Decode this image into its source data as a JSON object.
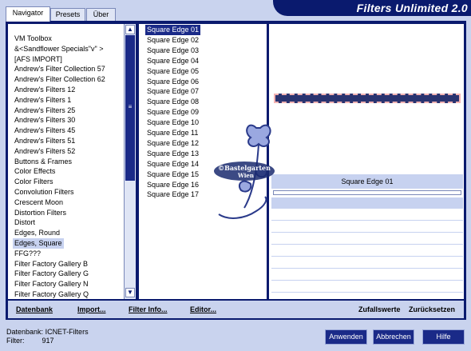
{
  "app": {
    "title": "Filters Unlimited 2.0"
  },
  "tabs": [
    {
      "label": "Navigator",
      "active": true
    },
    {
      "label": "Presets",
      "active": false
    },
    {
      "label": "Über",
      "active": false
    }
  ],
  "categories": [
    "VM Toolbox",
    "&<Sandflower Specials\"v\" >",
    "[AFS IMPORT]",
    "Andrew's Filter Collection 57",
    "Andrew's Filter Collection 62",
    "Andrew's Filters 12",
    "Andrew's Filters 1",
    "Andrew's Filters 25",
    "Andrew's Filters 30",
    "Andrew's Filters 45",
    "Andrew's Filters 51",
    "Andrew's Filters 52",
    "Buttons & Frames",
    "Color Effects",
    "Color Filters",
    "Convolution Filters",
    "Crescent Moon",
    "Distortion Filters",
    "Distort",
    "Edges, Round",
    "Edges, Square",
    "FFG???",
    "Filter Factory Gallery B",
    "Filter Factory Gallery G",
    "Filter Factory Gallery N",
    "Filter Factory Gallery Q"
  ],
  "selected_category": "Edges, Square",
  "filters": [
    "Square Edge 01",
    "Square Edge 02",
    "Square Edge 03",
    "Square Edge 04",
    "Square Edge 05",
    "Square Edge 06",
    "Square Edge 07",
    "Square Edge 08",
    "Square Edge 09",
    "Square Edge 10",
    "Square Edge 11",
    "Square Edge 12",
    "Square Edge 13",
    "Square Edge 14",
    "Square Edge 15",
    "Square Edge 16",
    "Square Edge 17"
  ],
  "selected_filter": "Square Edge 01",
  "control_header": "Square Edge 01",
  "watermark": {
    "line1": "©Bastelgarten",
    "line2": "Wien"
  },
  "toolbar": {
    "datenbank": "Datenbank",
    "import": "Import...",
    "filter_info": "Filter Info...",
    "editor": "Editor...",
    "zufallswerte": "Zufallswerte",
    "zuruecksetzen": "Zurücksetzen"
  },
  "status": {
    "datenbank_label": "Datenbank:",
    "datenbank_value": "ICNET-Filters",
    "filter_label": "Filter:",
    "filter_value": "917"
  },
  "buttons": {
    "apply": "Anwenden",
    "cancel": "Abbrechen",
    "help": "Hilfe"
  },
  "icons": {
    "scroll_up": "chevron-up-icon",
    "scroll_down": "chevron-down-icon",
    "grip": "grip-icon"
  },
  "colors": {
    "frame": "#0a1a6e",
    "accent": "#1a2a88",
    "selection": "#c7d2f0",
    "background": "#c9d3ee"
  }
}
